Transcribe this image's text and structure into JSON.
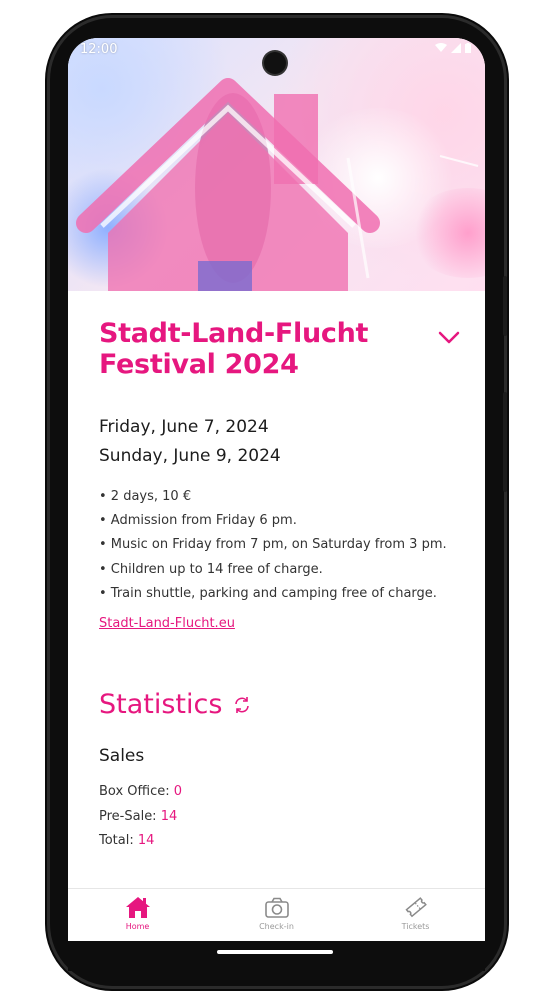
{
  "status_bar": {
    "time": "12:00"
  },
  "event": {
    "title_line1": "Stadt-Land-Flucht",
    "title_line2": "Festival 2024",
    "date_start": "Friday, June 7, 2024",
    "date_end": "Sunday, June 9, 2024",
    "details": [
      "• 2 days, 10 €",
      "• Admission from Friday 6 pm.",
      "• Music on Friday from 7 pm, on Saturday from 3 pm.",
      "• Children up to 14 free of charge.",
      "• Train shuttle, parking and camping free of charge."
    ],
    "website": "Stadt-Land-Flucht.eu"
  },
  "statistics": {
    "title": "Statistics",
    "sales_heading": "Sales",
    "box_office_label": "Box Office: ",
    "box_office_value": "0",
    "presale_label": "Pre-Sale: ",
    "presale_value": "14",
    "total_label": "Total: ",
    "total_value": "14"
  },
  "bottom_nav": {
    "items": [
      {
        "label": "Home",
        "icon": "home-icon",
        "active": true
      },
      {
        "label": "Check-in",
        "icon": "camera-icon",
        "active": false
      },
      {
        "label": "Tickets",
        "icon": "ticket-icon",
        "active": false
      }
    ]
  },
  "colors": {
    "accent": "#e6177f",
    "text": "#1c1c1c",
    "muted": "#9a9a9a"
  }
}
